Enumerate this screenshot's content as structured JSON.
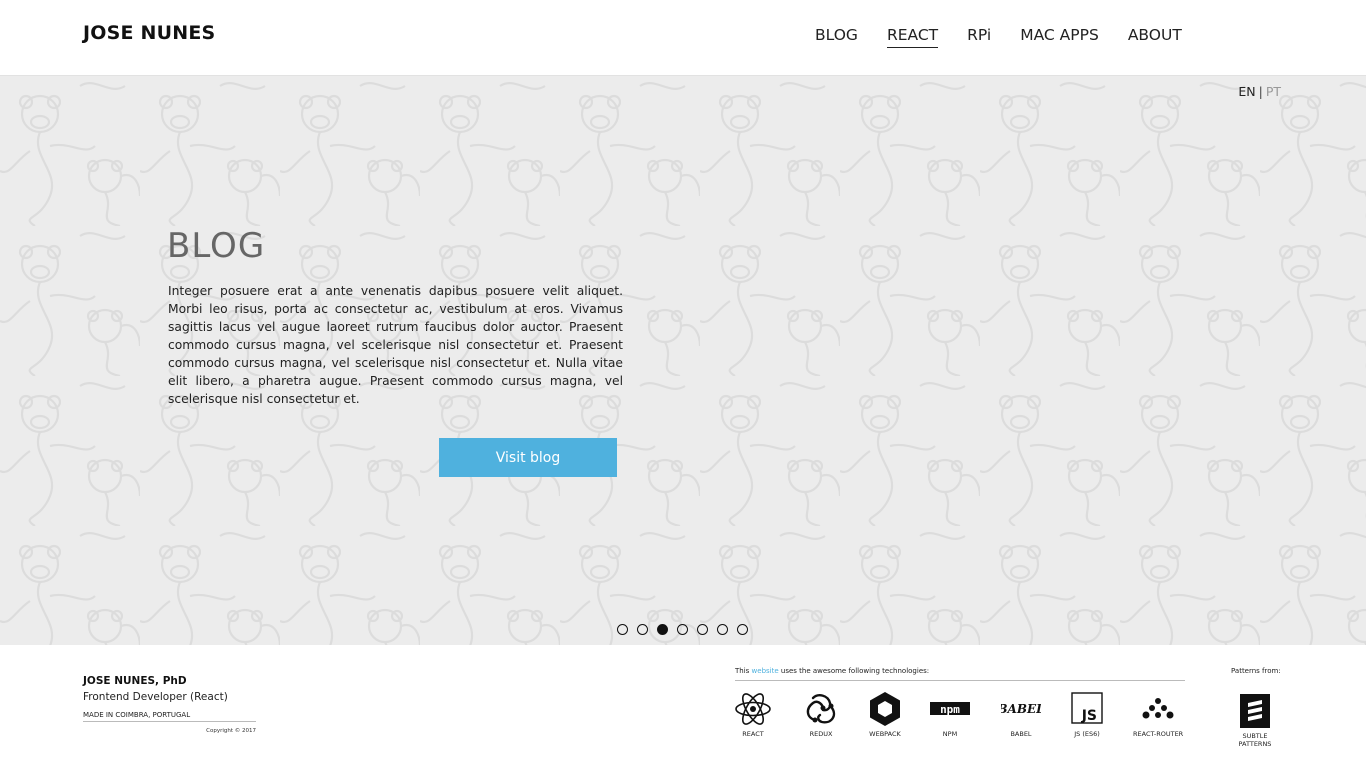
{
  "header": {
    "brand": "JOSE NUNES",
    "nav": [
      {
        "label": "BLOG",
        "active": false
      },
      {
        "label": "REACT",
        "active": true
      },
      {
        "label": "RPi",
        "active": false
      },
      {
        "label": "MAC APPS",
        "active": false
      },
      {
        "label": "ABOUT",
        "active": false
      }
    ]
  },
  "lang": {
    "en": "EN",
    "sep": "|",
    "pt": "PT"
  },
  "hero": {
    "title": "BLOG",
    "text": "Integer posuere erat a ante venenatis dapibus posuere velit aliquet. Morbi leo risus, porta ac consectetur ac, vestibulum at eros. Vivamus sagittis lacus vel augue laoreet rutrum faucibus dolor auctor. Praesent commodo cursus magna, vel scel­erisque nisl consectetur et. Praesent commodo cursus magna, vel scelerisque nisl consectetur et. Nulla vitae elit libero, a pharetra augue. Praesent commodo cursus magna, vel scelerisque nisl consectetur et.",
    "button": "Visit blog",
    "accent": "#4fb1de",
    "slides_total": 7,
    "slide_active": 3
  },
  "footer": {
    "name": "JOSE NUNES, PhD",
    "role": "Frontend Developer (React)",
    "made": "MADE IN COIMBRA, PORTUGAL",
    "copyright": "Copyright © 2017",
    "tech_prefix": "This ",
    "tech_link": "website",
    "tech_suffix": " uses the awesome following technologies:",
    "technologies": [
      {
        "label": "REACT",
        "icon": "react-icon"
      },
      {
        "label": "REDUX",
        "icon": "redux-icon"
      },
      {
        "label": "WEBPACK",
        "icon": "webpack-icon"
      },
      {
        "label": "NPM",
        "icon": "npm-icon"
      },
      {
        "label": "BABEL",
        "icon": "babel-icon"
      },
      {
        "label": "JS (ES6)",
        "icon": "js-icon"
      },
      {
        "label": "REACT-ROUTER",
        "icon": "react-router-icon"
      }
    ],
    "patterns_head": "Patterns from:",
    "patterns_label_1": "SUBTLE",
    "patterns_label_2": "PATTERNS"
  }
}
